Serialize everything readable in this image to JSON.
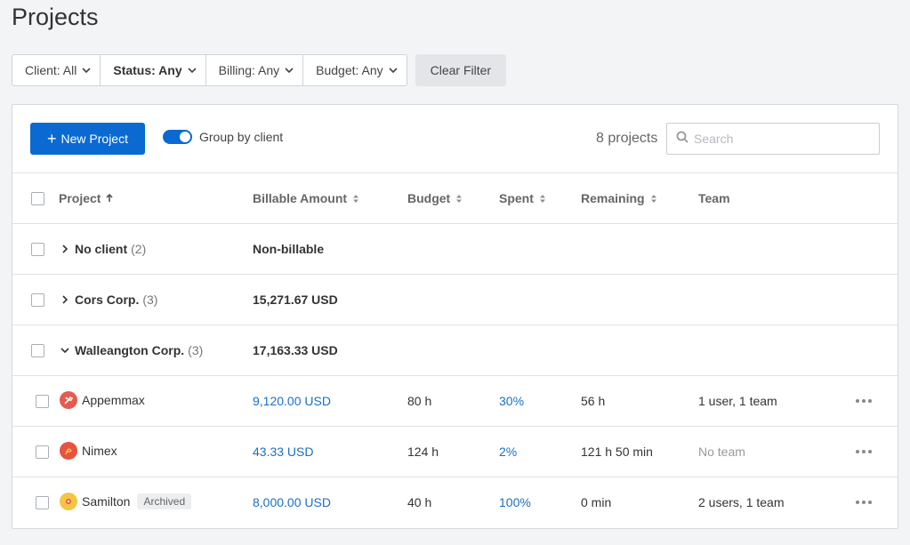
{
  "page": {
    "title": "Projects"
  },
  "filters": {
    "client": "Client: All",
    "status": "Status: Any",
    "billing": "Billing: Any",
    "budget": "Budget: Any",
    "clear": "Clear Filter"
  },
  "toolbar": {
    "new_project": "New Project",
    "group_by_client": "Group by client",
    "group_by_client_on": true,
    "count": "8 projects",
    "search_placeholder": "Search"
  },
  "columns": {
    "project": "Project",
    "billable": "Billable Amount",
    "budget": "Budget",
    "spent": "Spent",
    "remaining": "Remaining",
    "team": "Team"
  },
  "groups": [
    {
      "name": "No client",
      "count": "(2)",
      "amount": "Non-billable",
      "expanded": false
    },
    {
      "name": "Cors Corp.",
      "count": "(3)",
      "amount": "15,271.67 USD",
      "expanded": false
    },
    {
      "name": "Walleangton Corp.",
      "count": "(3)",
      "amount": "17,163.33 USD",
      "expanded": true
    }
  ],
  "projects": [
    {
      "name": "Appemmax",
      "icon": "appemmax-avatar-icon",
      "icon_color": "#e65a4f",
      "billable": "9,120.00 USD",
      "budget": "80 h",
      "spent": "30%",
      "remaining": "56 h",
      "team": "1 user, 1 team",
      "badge": ""
    },
    {
      "name": "Nimex",
      "icon": "nimex-avatar-icon",
      "icon_color": "#e8533f",
      "billable": "43.33 USD",
      "budget": "124 h",
      "spent": "2%",
      "remaining": "121 h 50 min",
      "team": "No team",
      "badge": ""
    },
    {
      "name": "Samilton",
      "icon": "samilton-avatar-icon",
      "icon_color": "#f4c542",
      "billable": "8,000.00 USD",
      "budget": "40 h",
      "spent": "100%",
      "remaining": "0 min",
      "team": "2 users, 1 team",
      "badge": "Archived"
    }
  ],
  "colors": {
    "primary": "#0a6ad1",
    "link": "#1a6fc4"
  }
}
